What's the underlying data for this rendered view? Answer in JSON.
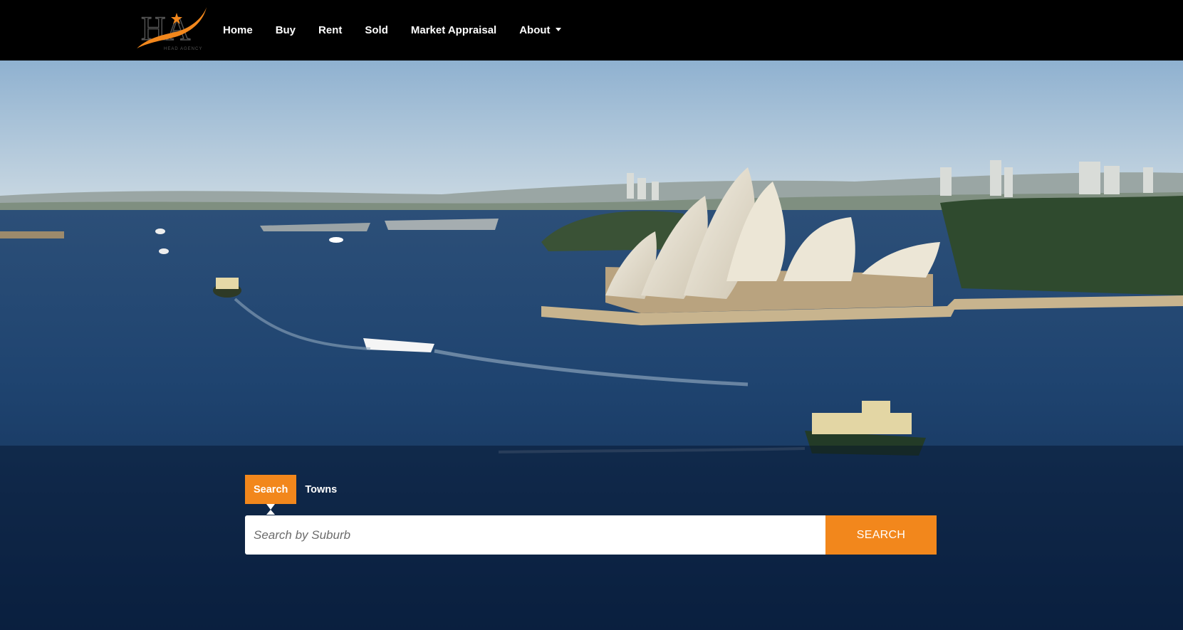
{
  "brand": {
    "logo_text": "HA",
    "logo_subtext": "HEAD AGENCY",
    "accent_color": "#f2871c"
  },
  "nav": {
    "items": [
      {
        "label": "Home"
      },
      {
        "label": "Buy"
      },
      {
        "label": "Rent"
      },
      {
        "label": "Sold"
      },
      {
        "label": "Market Appraisal"
      },
      {
        "label": "About",
        "dropdown": true
      }
    ]
  },
  "hero": {
    "image_subject": "sydney-harbour-opera-house"
  },
  "search": {
    "tabs": [
      {
        "label": "Search",
        "active": true
      },
      {
        "label": "Towns",
        "active": false
      }
    ],
    "placeholder": "Search by Suburb",
    "button_label": "SEARCH"
  }
}
